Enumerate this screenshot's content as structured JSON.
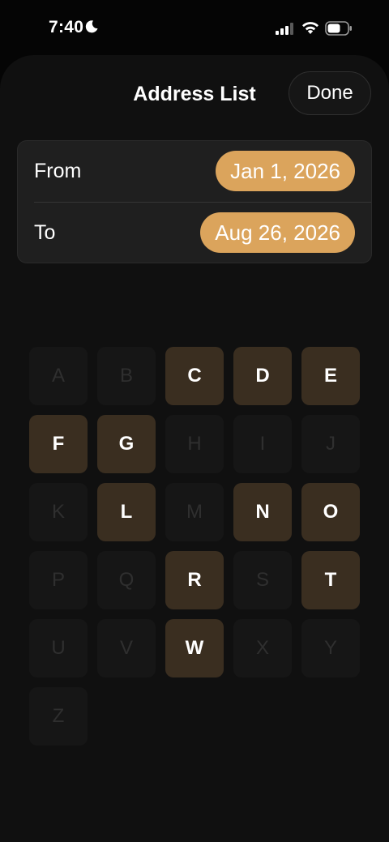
{
  "status_bar": {
    "time": "7:40"
  },
  "header": {
    "title": "Address List",
    "done_label": "Done"
  },
  "date_range": {
    "from_label": "From",
    "from_value": "Jan 1, 2026",
    "to_label": "To",
    "to_value": "Aug 26, 2026"
  },
  "letters": [
    {
      "letter": "A",
      "enabled": false
    },
    {
      "letter": "B",
      "enabled": false
    },
    {
      "letter": "C",
      "enabled": true
    },
    {
      "letter": "D",
      "enabled": true
    },
    {
      "letter": "E",
      "enabled": true
    },
    {
      "letter": "F",
      "enabled": true
    },
    {
      "letter": "G",
      "enabled": true
    },
    {
      "letter": "H",
      "enabled": false
    },
    {
      "letter": "I",
      "enabled": false
    },
    {
      "letter": "J",
      "enabled": false
    },
    {
      "letter": "K",
      "enabled": false
    },
    {
      "letter": "L",
      "enabled": true
    },
    {
      "letter": "M",
      "enabled": false
    },
    {
      "letter": "N",
      "enabled": true
    },
    {
      "letter": "O",
      "enabled": true
    },
    {
      "letter": "P",
      "enabled": false
    },
    {
      "letter": "Q",
      "enabled": false
    },
    {
      "letter": "R",
      "enabled": true
    },
    {
      "letter": "S",
      "enabled": false
    },
    {
      "letter": "T",
      "enabled": true
    },
    {
      "letter": "U",
      "enabled": false
    },
    {
      "letter": "V",
      "enabled": false
    },
    {
      "letter": "W",
      "enabled": true
    },
    {
      "letter": "X",
      "enabled": false
    },
    {
      "letter": "Y",
      "enabled": false
    },
    {
      "letter": "Z",
      "enabled": false
    }
  ],
  "colors": {
    "accent": "#dba45c",
    "tile_enabled": "#3a2e20",
    "tile_disabled": "#161616"
  },
  "icons": {
    "moon": "moon-icon",
    "signal": "cellular-signal-icon",
    "wifi": "wifi-icon",
    "battery": "battery-icon"
  }
}
